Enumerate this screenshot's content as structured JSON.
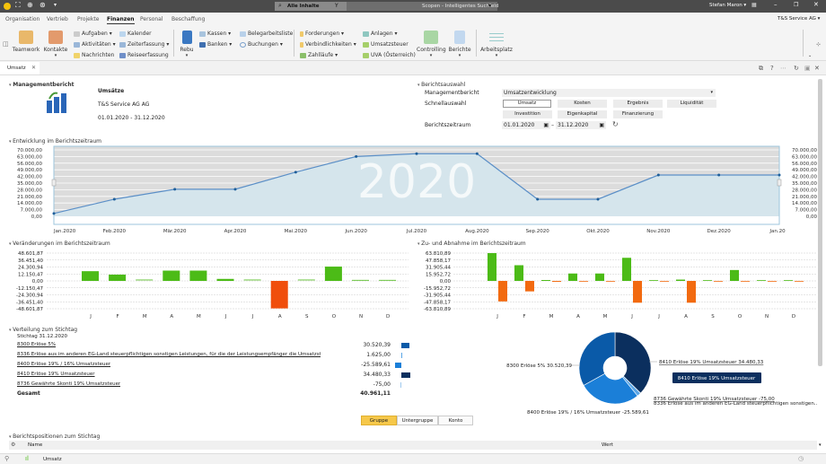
{
  "titlebar": {
    "search_scope": "Alle Inhalte",
    "search_placeholder": "Scopen - Intelligentes Suchfeld",
    "user": "Stefan Maron ▾"
  },
  "menu": {
    "tabs": [
      "Organisation",
      "Vertrieb",
      "Projekte",
      "Finanzen",
      "Personal",
      "Beschaffung"
    ],
    "active": "Finanzen",
    "company": "T&S Service AG ▾"
  },
  "ribbon": {
    "teamwork": "Teamwork",
    "kontakte": "Kontakte",
    "aufgaben": "Aufgaben ▾",
    "aktivitaeten": "Aktivitäten ▾",
    "nachrichten": "Nachrichten",
    "kalender": "Kalender",
    "zeiterfassung": "Zeiterfassung ▾",
    "reiseerfassung": "Reiseerfassung",
    "rebu": "Rebu",
    "kassen": "Kassen ▾",
    "banken": "Banken ▾",
    "belegarbeitsliste": "Belegarbeitsliste",
    "buchungen": "Buchungen ▾",
    "forderungen": "Forderungen ▾",
    "verbindlichkeiten": "Verbindlichkeiten ▾",
    "zahllaeufe": "Zahlläufe ▾",
    "anlagen": "Anlagen ▾",
    "umsatzsteuer": "Umsatzsteuer",
    "uva": "UVA (Österreich)",
    "controlling": "Controlling",
    "berichte": "Berichte",
    "arbeitsplatz": "Arbeitsplatz"
  },
  "doc_tab": {
    "label": "Umsatz"
  },
  "management": {
    "header": "Managementbericht",
    "title": "Umsätze",
    "company": "T&S Service AG AG",
    "period": "01.01.2020 - 31.12.2020"
  },
  "selection": {
    "header": "Berichtsauswahl",
    "report_label": "Managementbericht",
    "report_value": "Umsatzentwicklung",
    "quick_label": "Schnellauswahl",
    "quick": [
      "Umsatz",
      "Kosten",
      "Ergebnis",
      "Liquidität",
      "Investition",
      "Eigenkapital",
      "Finanzierung"
    ],
    "quick_selected": "Umsatz",
    "period_label": "Berichtszeitraum",
    "from": "01.01.2020",
    "to": "31.12.2020",
    "dash": "–"
  },
  "chart_data": [
    {
      "type": "line",
      "title": "Entwicklung im Berichtszeitraum",
      "watermark": "2020",
      "categories": [
        "Jan.2020",
        "Feb.2020",
        "Mär.2020",
        "Apr.2020",
        "Mai.2020",
        "Jun.2020",
        "Jul.2020",
        "Aug.2020",
        "Sep.2020",
        "Okt.2020",
        "Nov.2020",
        "Dez.2020",
        "Jan.2021"
      ],
      "values": [
        3000,
        18000,
        28500,
        28500,
        46500,
        63000,
        66000,
        66000,
        18000,
        18000,
        43500,
        43500,
        43500
      ],
      "yticks": [
        "70.000,00",
        "63.000,00",
        "56.000,00",
        "49.000,00",
        "42.000,00",
        "35.000,00",
        "28.000,00",
        "21.000,00",
        "14.000,00",
        "7.000,00",
        "0,00"
      ],
      "ylim": [
        0,
        70000
      ],
      "grid": true,
      "colors": {
        "line": "#5b8fc7",
        "area": "#d5e5ec",
        "bg": "#dcdcdc"
      }
    },
    {
      "type": "bar",
      "title": "Veränderungen im Berichtszeitraum",
      "categories": [
        "J",
        "F",
        "M",
        "A",
        "M",
        "J",
        "J",
        "A",
        "S",
        "O",
        "N",
        "D"
      ],
      "values": [
        17000,
        11000,
        1000,
        18000,
        18000,
        3500,
        1000,
        -48000,
        1000,
        25000,
        500,
        500
      ],
      "yticks": [
        "48.601,87",
        "36.451,40",
        "24.300,94",
        "12.150,47",
        "0,00",
        "-12.150,47",
        "-24.300,94",
        "-36.451,40",
        "-48.601,87"
      ],
      "ylim": [
        -48601.87,
        48601.87
      ],
      "colors": {
        "positive": "#4cbb17",
        "negative": "#f04e0c"
      }
    },
    {
      "type": "bar",
      "title": "Zu- und Abnahme im Berichtszeitraum",
      "categories": [
        "J",
        "F",
        "M",
        "A",
        "M",
        "J",
        "J",
        "A",
        "S",
        "O",
        "N",
        "D"
      ],
      "series": [
        {
          "values": [
            63800,
            36000,
            2000,
            17000,
            17000,
            53000,
            1000,
            3000,
            1000,
            25000,
            500,
            500
          ]
        },
        {
          "values": [
            -47000,
            -24000,
            -2000,
            -500,
            -500,
            -50000,
            -500,
            -50000,
            -500,
            -500,
            -500,
            -500
          ]
        }
      ],
      "yticks": [
        "63.810,89",
        "47.858,17",
        "31.905,44",
        "15.952,72",
        "0,00",
        "-15.952,72",
        "-31.905,44",
        "-47.858,17",
        "-63.810,89"
      ],
      "ylim": [
        -63810.89,
        63810.89
      ],
      "colors": {
        "increase": "#4cbb17",
        "decrease": "#f26a10"
      }
    },
    {
      "type": "pie",
      "title": "Verteilung zum Stichtag",
      "slices": [
        {
          "label": "8410 Erlöse 19% Umsatzsteuer 34.480,33",
          "value": 34480.33,
          "color": "#0b2f5e"
        },
        {
          "label": "8736 Gewährte Skonti 19% Umsatzsteuer -75,00",
          "value": 75,
          "color": "#9fc9ee"
        },
        {
          "label": "8336 Erlöse aus im anderen EG-Land steuerpflichtigen sonstigen...",
          "value": 1625,
          "color": "#5aa6e6"
        },
        {
          "label": "8400 Erlöse 19% / 16% Umsatzsteuer -25.589,61",
          "value": 25589.61,
          "color": "#1b7fd8"
        },
        {
          "label": "8300 Erlöse 5% 30.520,39",
          "value": 30520.39,
          "color": "#0a5aa8"
        }
      ],
      "tooltip": "8410 Erlöse 19% Umsatzsteuer"
    }
  ],
  "distribution": {
    "header": "Verteilung zum Stichtag",
    "stichtag": "Stichtag 31.12.2020",
    "rows": [
      {
        "name": "8300 Erlöse 5%",
        "value": "30.520,39",
        "color": "#0a5aa8",
        "amount": 30520.39
      },
      {
        "name": "8336 Erlöse aus im anderen EG-Land steuerpflichtigen sonstigen Leistungen, für die der Leistungsempfänger die Umsatzsteuer schuldet",
        "value": "1.625,00",
        "color": "#5aa6e6",
        "amount": 1625
      },
      {
        "name": "8400 Erlöse 19% / 16% Umsatzsteuer",
        "value": "-25.589,61",
        "color": "#1b7fd8",
        "amount": -25589.61
      },
      {
        "name": "8410 Erlöse 19% Umsatzsteuer",
        "value": "34.480,33",
        "color": "#0b2f5e",
        "amount": 34480.33
      },
      {
        "name": "8736 Gewährte Skonti 19% Umsatzsteuer",
        "value": "-75,00",
        "color": "#9fc9ee",
        "amount": -75
      }
    ],
    "total_label": "Gesamt",
    "total_value": "40.961,11"
  },
  "grouping": {
    "options": [
      "Gruppe",
      "Untergruppe",
      "Konto"
    ],
    "selected": "Gruppe"
  },
  "positions": {
    "header": "Berichtspositionen zum Stichtag",
    "col_name": "Name",
    "col_value": "Wert"
  },
  "statusbar": {
    "label": "Umsatz"
  }
}
